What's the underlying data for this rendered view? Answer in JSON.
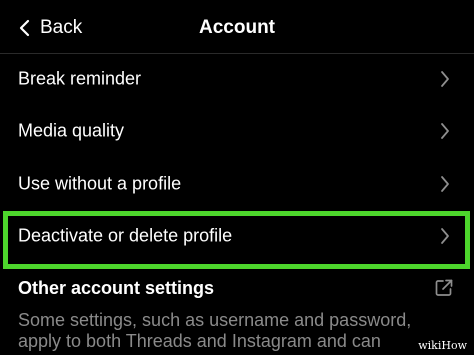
{
  "header": {
    "back_label": "Back",
    "title": "Account"
  },
  "rows": [
    {
      "label": "Break reminder",
      "icon": "chevron-right-icon"
    },
    {
      "label": "Media quality",
      "icon": "chevron-right-icon"
    },
    {
      "label": "Use without a profile",
      "icon": "chevron-right-icon"
    },
    {
      "label": "Deactivate or delete profile",
      "icon": "chevron-right-icon",
      "highlighted": true
    }
  ],
  "other_settings": {
    "title": "Other account settings",
    "icon": "external-link-icon",
    "description": "Some settings, such as username and password, apply to both Threads and Instagram and can"
  },
  "colors": {
    "background": "#000000",
    "text": "#ffffff",
    "secondary_text": "#8a8a8a",
    "chevron": "#8e8e8e",
    "highlight": "#4dd62c"
  },
  "watermark": "wikiHow"
}
